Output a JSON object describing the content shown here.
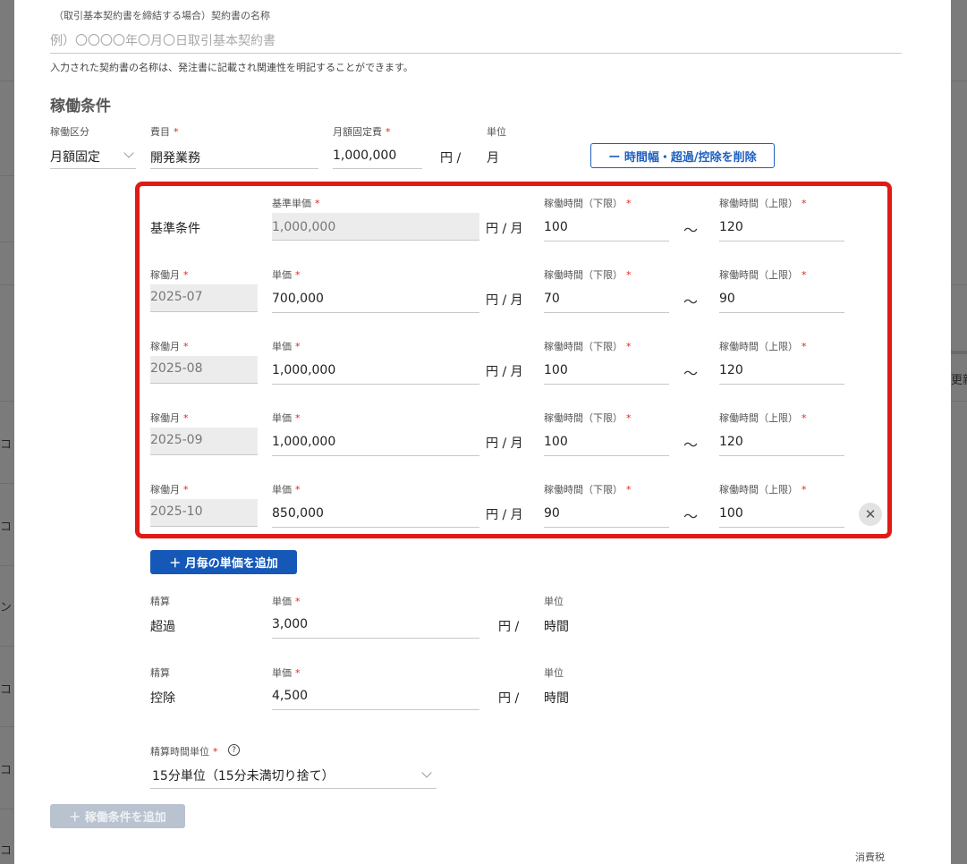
{
  "background": {
    "left_fragments": [
      "コ",
      "コ",
      "ン・",
      "コ",
      "コ",
      "コ"
    ],
    "right_fragment": "更新"
  },
  "contract_name": {
    "label": "（取引基本契約書を締結する場合）契約書の名称",
    "placeholder": "例）〇〇〇〇年〇月〇日取引基本契約書",
    "help": "入力された契約書の名称は、発注書に記載され関連性を明記することができます。"
  },
  "work_conditions": {
    "title": "稼働条件",
    "type_label": "稼働区分",
    "type_value": "月額固定",
    "item_label": "費目",
    "item_value": "開発業務",
    "fixed_fee_label": "月額固定費",
    "fixed_fee_value": "1,000,000",
    "yen_per": "円 /",
    "unit_label": "単位",
    "unit_value": "月",
    "remove_button": "ー 時間幅・超過/控除を削除"
  },
  "base": {
    "row_label": "基準条件",
    "price_label": "基準単価",
    "price_value": "1,000,000",
    "unit": "円 / 月",
    "lower_label": "稼働時間（下限）",
    "lower_value": "100",
    "tilde": "〜",
    "upper_label": "稼働時間（上限）",
    "upper_value": "120"
  },
  "monthly_rows": [
    {
      "month_label": "稼働月",
      "month": "2025-07",
      "price_label": "単価",
      "price": "700,000",
      "unit": "円 / 月",
      "lower_label": "稼働時間（下限）",
      "lower": "70",
      "tilde": "〜",
      "upper_label": "稼働時間（上限）",
      "upper": "90"
    },
    {
      "month_label": "稼働月",
      "month": "2025-08",
      "price_label": "単価",
      "price": "1,000,000",
      "unit": "円 / 月",
      "lower_label": "稼働時間（下限）",
      "lower": "100",
      "tilde": "〜",
      "upper_label": "稼働時間（上限）",
      "upper": "120"
    },
    {
      "month_label": "稼働月",
      "month": "2025-09",
      "price_label": "単価",
      "price": "1,000,000",
      "unit": "円 / 月",
      "lower_label": "稼働時間（下限）",
      "lower": "100",
      "tilde": "〜",
      "upper_label": "稼働時間（上限）",
      "upper": "120"
    },
    {
      "month_label": "稼働月",
      "month": "2025-10",
      "price_label": "単価",
      "price": "850,000",
      "unit": "円 / 月",
      "lower_label": "稼働時間（下限）",
      "lower": "90",
      "tilde": "〜",
      "upper_label": "稼働時間（上限）",
      "upper": "100"
    }
  ],
  "close_symbol": "✕",
  "add_monthly_button": "＋ 月毎の単価を追加",
  "settlements": [
    {
      "settle_label": "精算",
      "settle_value": "超過",
      "price_label": "単価",
      "price": "3,000",
      "yen": "円 /",
      "unit_label": "単位",
      "unit_value": "時間"
    },
    {
      "settle_label": "精算",
      "settle_value": "控除",
      "price_label": "単価",
      "price": "4,500",
      "yen": "円 /",
      "unit_label": "単位",
      "unit_value": "時間"
    }
  ],
  "settle_unit": {
    "label": "精算時間単位",
    "help_symbol": "?",
    "value": "15分単位（15分未満切り捨て）"
  },
  "add_condition_button": "＋ 稼働条件を追加",
  "tax_label": "消費税"
}
